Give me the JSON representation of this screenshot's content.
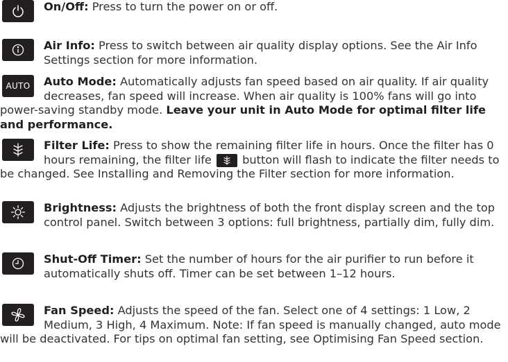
{
  "entries": [
    {
      "icon": "power-icon",
      "term": "On/Off:",
      "text": " Press to turn the power on or off."
    },
    {
      "icon": "info-icon",
      "term": "Air Info:",
      "text": " Press to switch between air quality display options. See the Air Info Settings section for more information."
    },
    {
      "icon": "auto-icon",
      "icon_text": "AUTO",
      "term": "Auto Mode:",
      "text": " Automatically adjusts fan speed based on air quality. If air quality decreases, fan speed will increase. When air quality is 100% fans will go into power-saving standby mode. ",
      "emphasis": "Leave your unit in Auto Mode for optimal filter life and performance."
    },
    {
      "icon": "filter-icon",
      "term": "Filter Life:",
      "text_before": " Press to show the remaining filter life in hours. Once the filter has 0 hours remaining, the filter life ",
      "inline_icon": "filter-icon",
      "text_after": " button will flash to indicate the filter needs to be changed. See Installing and Removing the Filter section for more information."
    },
    {
      "icon": "brightness-icon",
      "term": "Brightness:",
      "text": " Adjusts the brightness of both the front display screen and the top control panel. Switch between 3 options: full brightness, partially dim, fully dim."
    },
    {
      "icon": "clock-icon",
      "term": "Shut-Off Timer:",
      "text": " Set the number of hours for the air purifier to run before it automatically shuts off. Timer can be set between 1–12 hours."
    },
    {
      "icon": "fan-icon",
      "term": "Fan Speed:",
      "text": " Adjusts the speed of the fan. Select one of 4 settings: 1 Low, 2 Medium, 3 High, 4 Maximum. Note: If fan speed is manually changed, auto mode will be deactivated. For tips on optimal fan setting, see Optimising Fan Speed section."
    }
  ]
}
